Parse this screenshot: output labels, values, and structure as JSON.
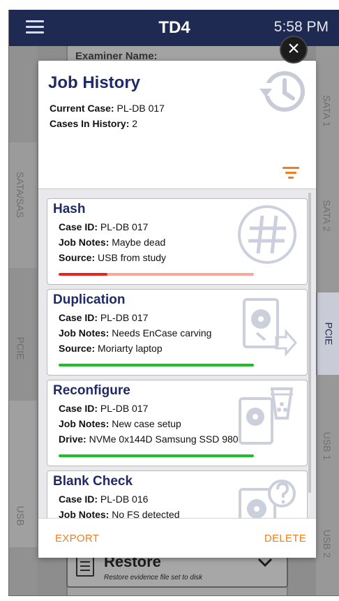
{
  "topbar": {
    "title": "TD4",
    "time": "5:58 PM"
  },
  "background": {
    "examiner_label": "Examiner Name:",
    "left_tabs": [
      "SATA/SAS",
      "PCIE",
      "USB"
    ],
    "right_tabs": [
      "SATA 1",
      "SATA 2",
      "PCIE",
      "USB 1",
      "USB 2"
    ],
    "restore": {
      "title": "Restore",
      "subtitle": "Restore evidence file set to disk"
    }
  },
  "modal": {
    "title": "Job History",
    "current_case_label": "Current Case:",
    "current_case_value": "PL-DB 017",
    "cases_in_history_label": "Cases In History:",
    "cases_in_history_value": "2",
    "jobs": [
      {
        "title": "Hash",
        "case_label": "Case ID:",
        "case_value": "PL-DB 017",
        "notes_label": "Job Notes:",
        "notes_value": "Maybe dead",
        "third_label": "Source:",
        "third_value": "USB from study",
        "progress": 0.25,
        "progress_color": "#e8251e",
        "progress_track": "#f5a99a",
        "icon": "hash-icon"
      },
      {
        "title": "Duplication",
        "case_label": "Case ID:",
        "case_value": "PL-DB 017",
        "notes_label": "Job Notes:",
        "notes_value": "Needs EnCase carving",
        "third_label": "Source:",
        "third_value": "Moriarty laptop",
        "progress": 1.0,
        "progress_color": "#1fbf2a",
        "progress_track": "#1fbf2a",
        "icon": "disk-duplicate-icon"
      },
      {
        "title": "Reconfigure",
        "case_label": "Case ID:",
        "case_value": "PL-DB 017",
        "notes_label": "Job Notes:",
        "notes_value": "New case setup",
        "third_label": "Drive:",
        "third_value": "NVMe 0x144D Samsung SSD 980",
        "progress": 1.0,
        "progress_color": "#1fbf2a",
        "progress_track": "#1fbf2a",
        "icon": "disk-reconfigure-icon"
      },
      {
        "title": "Blank Check",
        "case_label": "Case ID:",
        "case_value": "PL-DB 016",
        "notes_label": "Job Notes:",
        "notes_value": "No FS detected",
        "third_label": "",
        "third_value": "",
        "progress": null,
        "icon": "disk-question-icon"
      }
    ],
    "footer": {
      "export_label": "EXPORT",
      "delete_label": "DELETE"
    }
  },
  "colors": {
    "accent": "#f07d1e",
    "title_navy": "#1f2a66",
    "topbar": "#1f2a52"
  }
}
